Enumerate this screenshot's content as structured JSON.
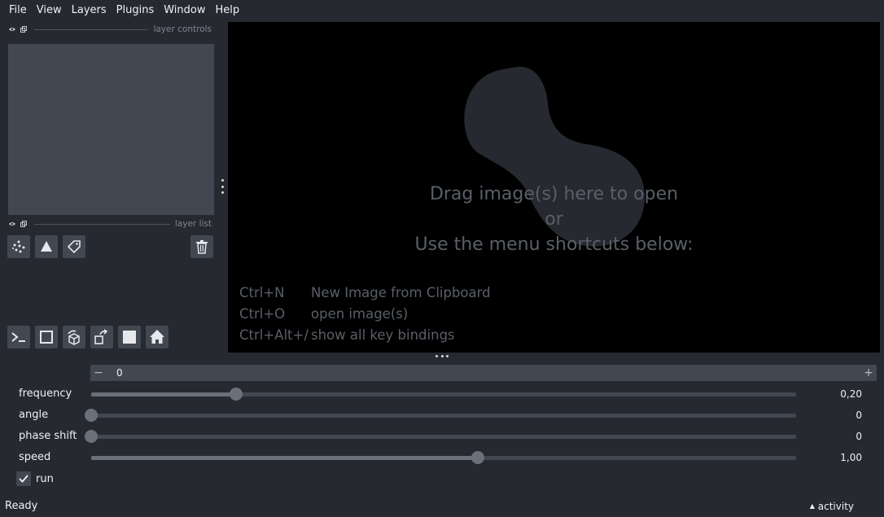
{
  "menu": [
    "File",
    "View",
    "Layers",
    "Plugins",
    "Window",
    "Help"
  ],
  "left_panel": {
    "layer_controls_label": "layer controls",
    "layer_list_label": "layer list"
  },
  "layer_buttons": {
    "new_points": "points-icon",
    "new_shapes": "shapes-icon",
    "new_labels": "labels-icon",
    "delete": "trash-icon"
  },
  "viewer_buttons": [
    "console-icon",
    "ndisplay-square-icon",
    "roll-cube-icon",
    "transpose-icon",
    "grid-square-icon",
    "home-icon"
  ],
  "welcome": {
    "line1": "Drag image(s) here to open",
    "line2": "or",
    "line3": "Use the menu shortcuts below:"
  },
  "shortcuts": [
    {
      "key": "Ctrl+N",
      "action": "New Image from Clipboard"
    },
    {
      "key": "Ctrl+O",
      "action": "open image(s)"
    },
    {
      "key": "Ctrl+Alt+/",
      "action": "show all key bindings"
    }
  ],
  "dims": {
    "minus": "−",
    "value": "0",
    "plus": "+"
  },
  "widgets": [
    {
      "label": "frequency",
      "value": "0,20",
      "fraction": 0.206
    },
    {
      "label": "angle",
      "value": "0",
      "fraction": 0.0
    },
    {
      "label": "phase shift",
      "value": "0",
      "fraction": 0.0
    },
    {
      "label": "speed",
      "value": "1,00",
      "fraction": 0.548
    }
  ],
  "run": {
    "label": "run",
    "checked": true
  },
  "status": "Ready",
  "activity": "activity",
  "colors": {
    "background": "#262930",
    "panel": "#414851",
    "canvas": "#000000",
    "text": "#f0f1f2",
    "muted": "#5a5f67"
  }
}
